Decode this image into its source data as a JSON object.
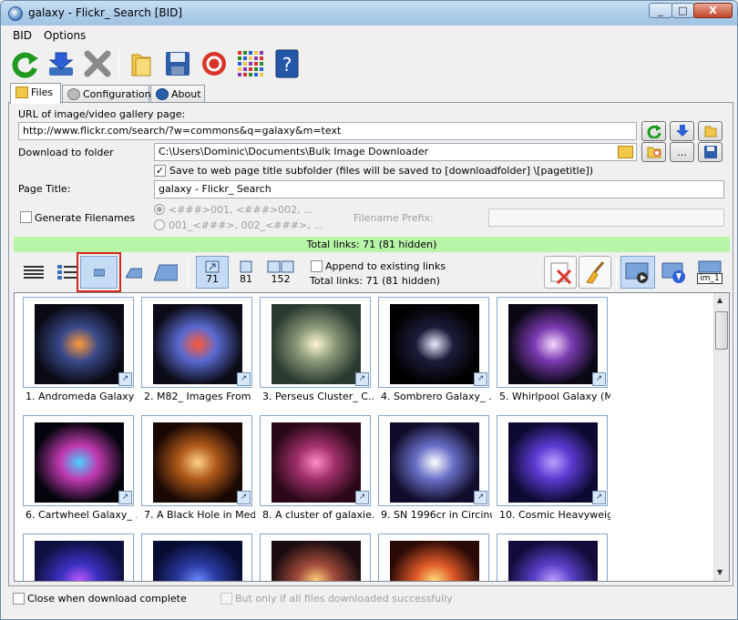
{
  "window": {
    "title": "galaxy - Flickr_ Search [BID]",
    "controls": {
      "minimize": "_",
      "maximize": "□",
      "close": "X"
    }
  },
  "menu": {
    "items": [
      "BID",
      "Options"
    ]
  },
  "toolbar": {
    "icons": [
      "refresh-icon",
      "download-icon",
      "stop-icon",
      "folder-icon",
      "save-icon",
      "help-ring-icon",
      "grid-icon",
      "help-book-icon"
    ]
  },
  "tabs": [
    {
      "label": "Files"
    },
    {
      "label": "Configuration"
    },
    {
      "label": "About"
    }
  ],
  "form": {
    "url_label": "URL of image/video gallery page:",
    "url_value": "http://www.flickr.com/search/?w=commons&q=galaxy&m=text",
    "download_label": "Download to folder",
    "download_value": "C:\\Users\\Dominic\\Documents\\Bulk Image Downloader",
    "subfolder_label": "Save to web page title subfolder (files will be saved to [downloadfolder] \\[pagetitle])",
    "subfolder_checked": true,
    "page_title_label": "Page Title:",
    "page_title_value": "galaxy - Flickr_ Search",
    "generate_label": "Generate Filenames",
    "generate_checked": false,
    "pattern1": "<###>001, <###>002, ...",
    "pattern2": "001_<###>, 002_<###>, ...",
    "prefix_label": "Filename Prefix:",
    "prefix_value": "",
    "more_button": "..."
  },
  "status": {
    "total_links": "Total links: 71 (81 hidden)"
  },
  "filters": {
    "count_a": "71",
    "count_b": "81",
    "count_c": "152"
  },
  "append": {
    "label": "Append to existing links",
    "total": "Total links: 71 (81 hidden)",
    "checked": false
  },
  "right_tools": {
    "last_label": "im_1"
  },
  "thumbnails": [
    {
      "caption": "1. Andromeda Galaxy ...",
      "colors": [
        "#ff9a3a",
        "#3a4a8a",
        "#0a0a14"
      ]
    },
    {
      "caption": "2. M82_ Images From ...",
      "colors": [
        "#ff5a3a",
        "#5a6ad0",
        "#0c0c18"
      ]
    },
    {
      "caption": "3. Perseus Cluster_ C...",
      "colors": [
        "#fff6d0",
        "#8a9a7a",
        "#2a3a30"
      ]
    },
    {
      "caption": "4. Sombrero Galaxy_ ...",
      "colors": [
        "#e8eefc",
        "#1c1c3a",
        "#000000"
      ]
    },
    {
      "caption": "5. Whirlpool Galaxy (M...",
      "colors": [
        "#f6d8ff",
        "#7a3ab0",
        "#0a0814"
      ]
    },
    {
      "caption": "6. Cartwheel Galaxy_ ...",
      "colors": [
        "#4ad0ff",
        "#c03ab0",
        "#04040c"
      ]
    },
    {
      "caption": "7. A Black Hole in Med...",
      "colors": [
        "#ffd08a",
        "#b05a1a",
        "#1a0804"
      ]
    },
    {
      "caption": "8. A cluster of galaxie...",
      "colors": [
        "#ff8ac8",
        "#a0306a",
        "#2a0818"
      ]
    },
    {
      "caption": "9. SN 1996cr in Circinu...",
      "colors": [
        "#ffffff",
        "#6a70c8",
        "#100c2a"
      ]
    },
    {
      "caption": "10. Cosmic Heavyweig...",
      "colors": [
        "#b8a0ff",
        "#5a3ad0",
        "#0c0a30"
      ]
    },
    {
      "caption": "",
      "colors": [
        "#c05aff",
        "#3a30c0",
        "#101040"
      ]
    },
    {
      "caption": "",
      "colors": [
        "#6a8aff",
        "#2a3aa0",
        "#080c30"
      ]
    },
    {
      "caption": "",
      "colors": [
        "#ffd07a",
        "#a04a3a",
        "#1a0c10"
      ]
    },
    {
      "caption": "",
      "colors": [
        "#ffe07a",
        "#e05a2a",
        "#2a0a06"
      ]
    },
    {
      "caption": "",
      "colors": [
        "#c0a0ff",
        "#5a40c8",
        "#120a38"
      ]
    }
  ],
  "footer": {
    "close_label": "Close when download complete",
    "close_checked": false,
    "only_label": "But only if all files downloaded successfully",
    "only_checked": false
  },
  "colors": {
    "status_bar": "#b9f5a9",
    "selected_view": "#c5dcf4",
    "highlight_box": "#d4271e",
    "titlebar": "#aecde9"
  }
}
